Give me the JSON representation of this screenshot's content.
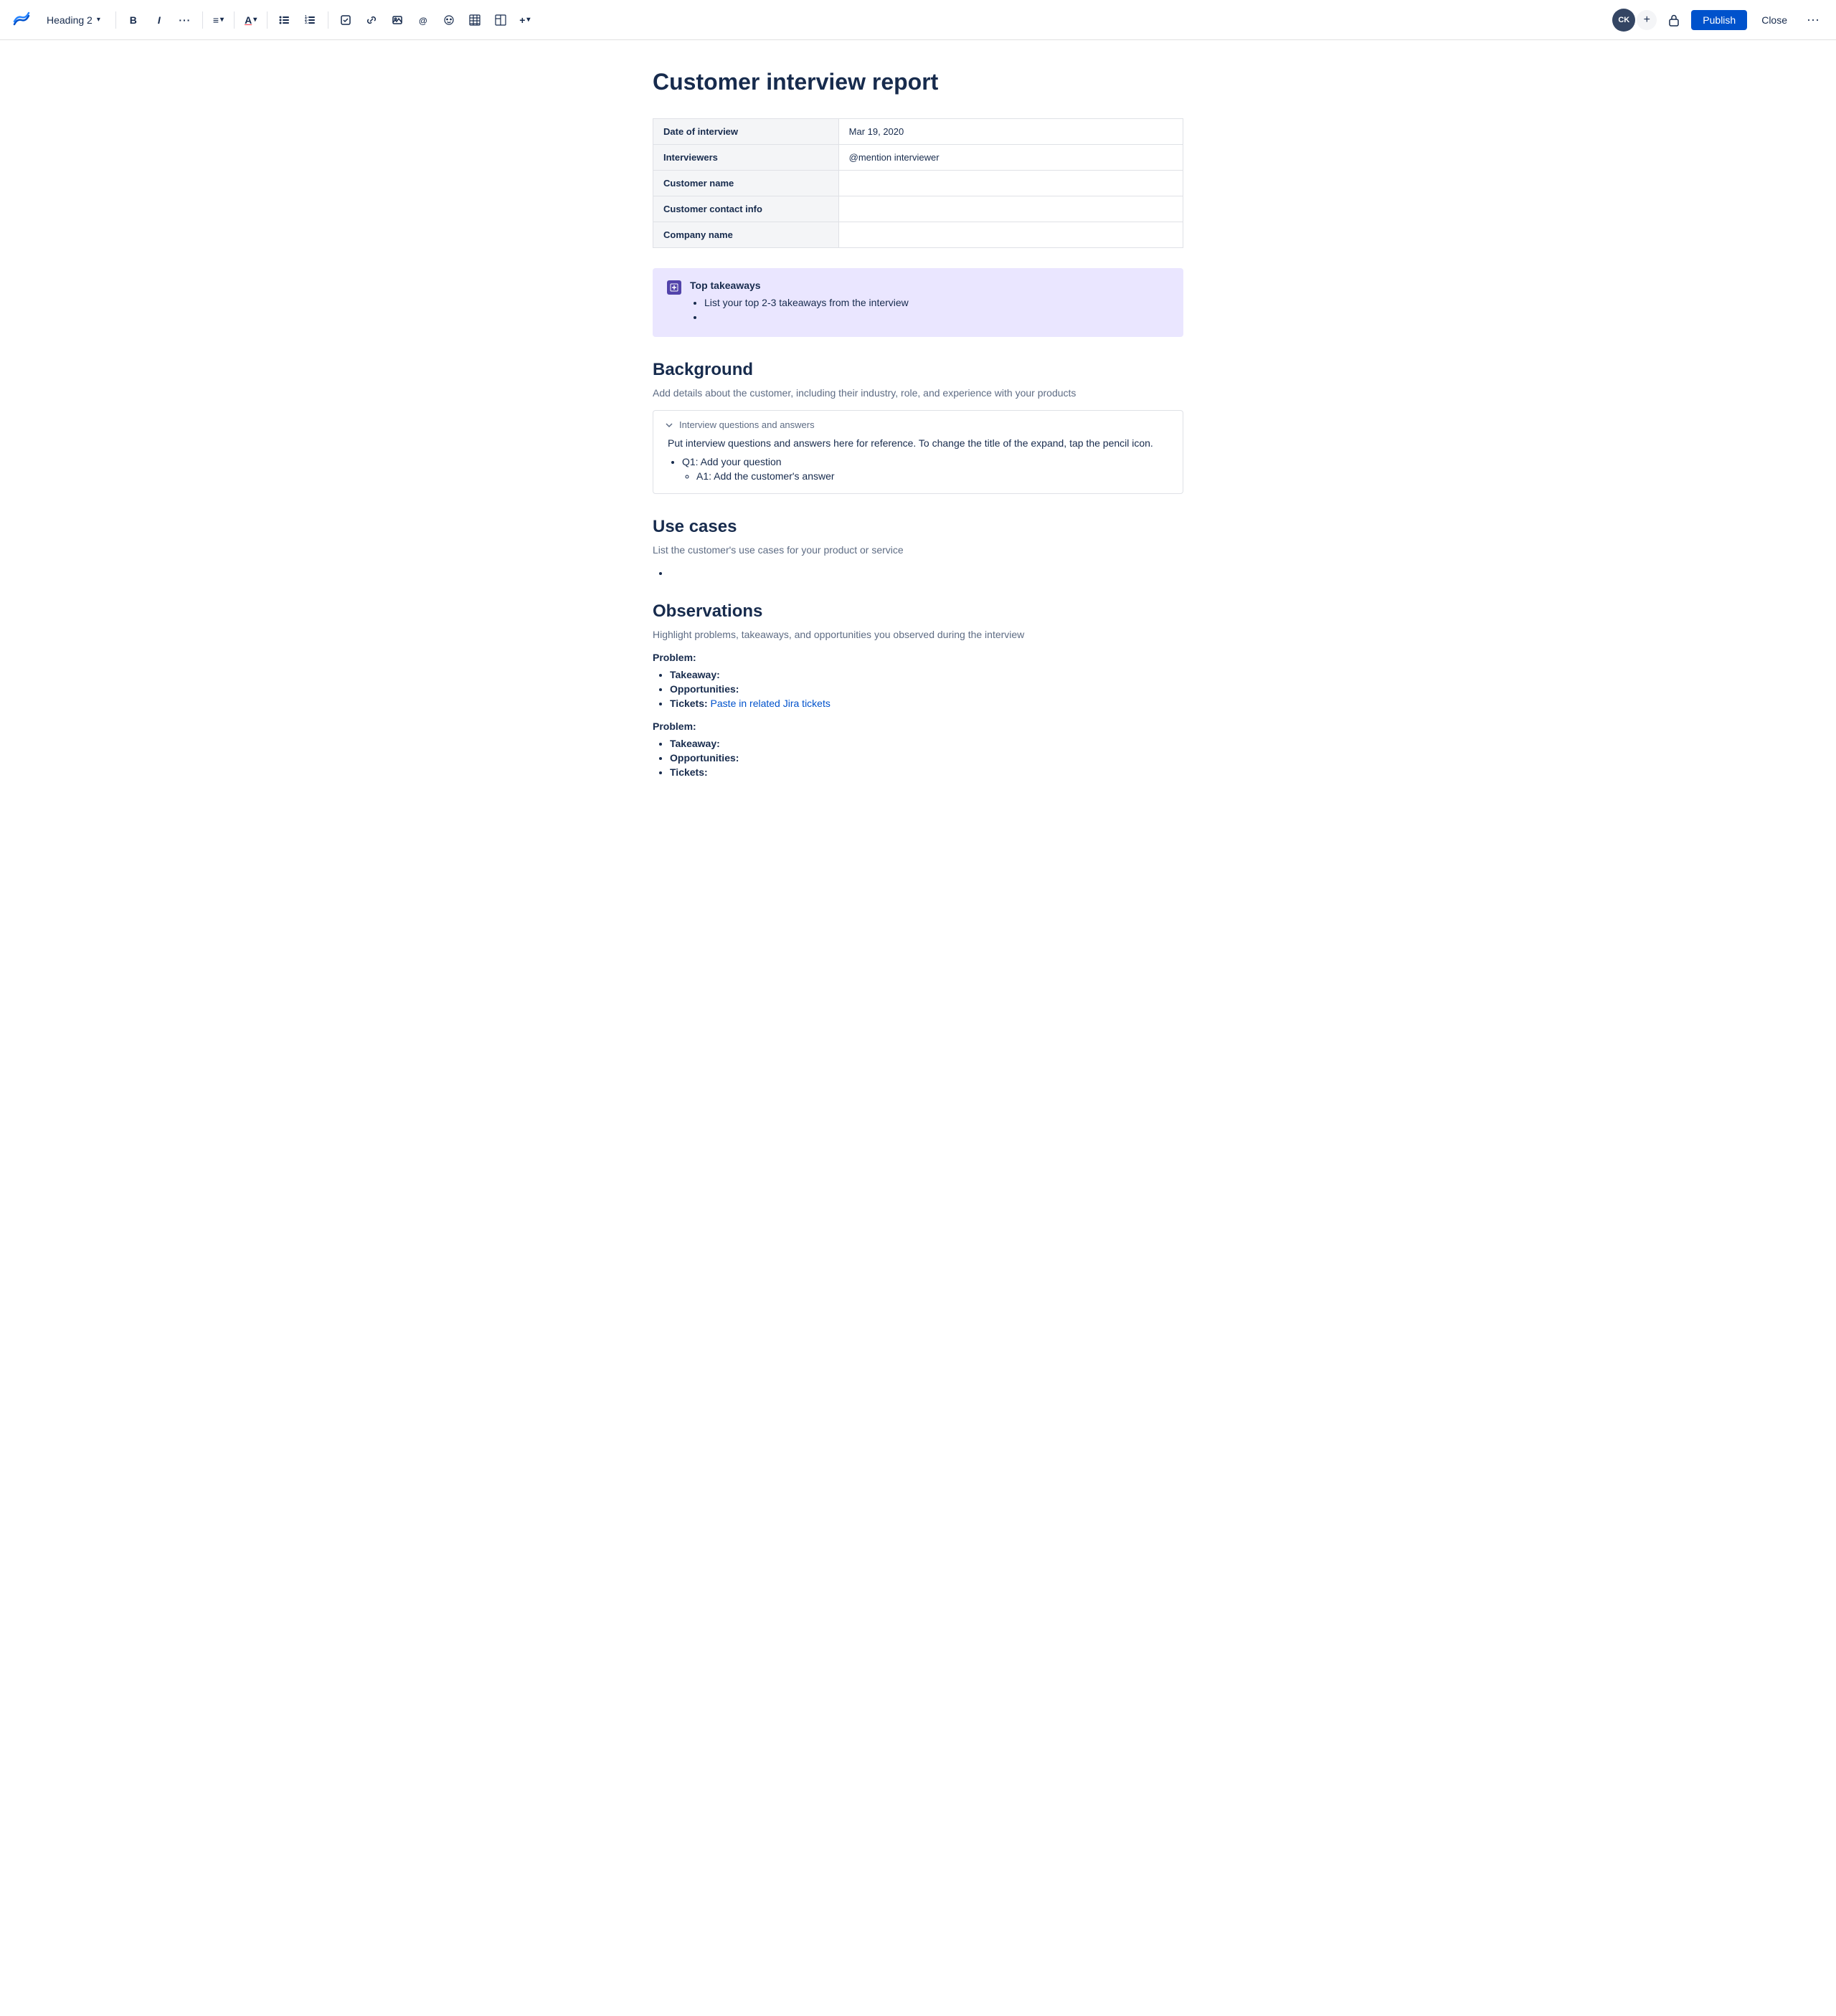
{
  "toolbar": {
    "logo_label": "Confluence",
    "heading_select": "Heading 2",
    "bold_label": "B",
    "italic_label": "I",
    "more_format_label": "···",
    "align_label": "≡",
    "text_color_label": "A",
    "bullet_list_label": "☰",
    "numbered_list_label": "☰",
    "task_label": "☑",
    "link_label": "🔗",
    "image_label": "🖼",
    "mention_label": "@",
    "emoji_label": "☺",
    "table_label": "⊞",
    "layout_label": "⊟",
    "more_insert_label": "+",
    "avatar_initials": "CK",
    "add_label": "+",
    "publish_label": "Publish",
    "close_label": "Close",
    "more_options_label": "···"
  },
  "page": {
    "title": "Customer interview report"
  },
  "info_table": {
    "rows": [
      {
        "label": "Date of interview",
        "value": "Mar 19, 2020"
      },
      {
        "label": "Interviewers",
        "value": "@mention interviewer"
      },
      {
        "label": "Customer name",
        "value": ""
      },
      {
        "label": "Customer contact info",
        "value": ""
      },
      {
        "label": "Company name",
        "value": ""
      }
    ]
  },
  "callout": {
    "title": "Top takeaways",
    "items": [
      "List your top 2-3 takeaways from the interview",
      ""
    ]
  },
  "background": {
    "heading": "Background",
    "description": "Add details about the customer, including their industry, role, and experience with your products",
    "expand": {
      "title": "Interview questions and answers",
      "body": "Put interview questions and answers here for reference. To change the title of the expand, tap the pencil icon.",
      "qa_list": [
        {
          "question": "Q1: Add your question",
          "answer": "A1: Add the customer's answer"
        }
      ]
    }
  },
  "use_cases": {
    "heading": "Use cases",
    "description": "List the customer's use cases for your product or service",
    "items": [
      ""
    ]
  },
  "observations": {
    "heading": "Observations",
    "description": "Highlight problems, takeaways, and opportunities you observed during the interview",
    "problems": [
      {
        "label": "Problem:",
        "items": [
          {
            "prefix": "Takeaway:",
            "value": ""
          },
          {
            "prefix": "Opportunities:",
            "value": ""
          },
          {
            "prefix": "Tickets:",
            "value": " Paste in related Jira tickets",
            "is_link": true
          }
        ]
      },
      {
        "label": "Problem:",
        "items": [
          {
            "prefix": "Takeaway:",
            "value": ""
          },
          {
            "prefix": "Opportunities:",
            "value": ""
          },
          {
            "prefix": "Tickets:",
            "value": ""
          }
        ]
      }
    ]
  }
}
